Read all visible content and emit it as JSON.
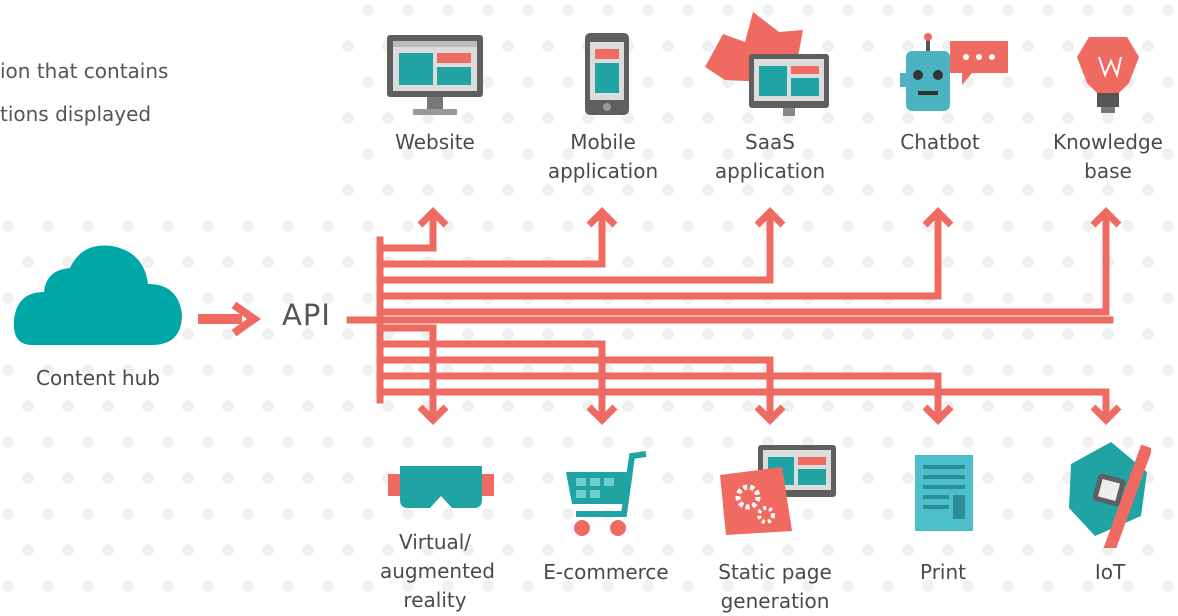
{
  "intro": {
    "line1": "ion that contains",
    "line2": "tions displayed"
  },
  "source": {
    "label": "Content hub"
  },
  "api": {
    "label": "API"
  },
  "colors": {
    "accent": "#ef6b61",
    "teal": "#00a7a7",
    "dots": "#f0f0f0",
    "text": "#4a4a4a"
  },
  "top_channels": [
    {
      "label": "Website",
      "icon": "website-monitor-icon"
    },
    {
      "label": "Mobile application",
      "icon": "mobile-phone-icon"
    },
    {
      "label": "SaaS application",
      "icon": "saas-cloud-monitor-icon"
    },
    {
      "label": "Chatbot",
      "icon": "chatbot-robot-icon"
    },
    {
      "label": "Knowledge base",
      "icon": "lightbulb-icon"
    }
  ],
  "bottom_channels": [
    {
      "label": "Virtual/ augmented reality",
      "icon": "vr-goggles-icon"
    },
    {
      "label": "E-commerce",
      "icon": "shopping-cart-icon"
    },
    {
      "label": "Static page generation",
      "icon": "static-page-gears-icon"
    },
    {
      "label": "Print",
      "icon": "printed-document-icon"
    },
    {
      "label": "IoT",
      "icon": "smartwatch-icon"
    }
  ]
}
